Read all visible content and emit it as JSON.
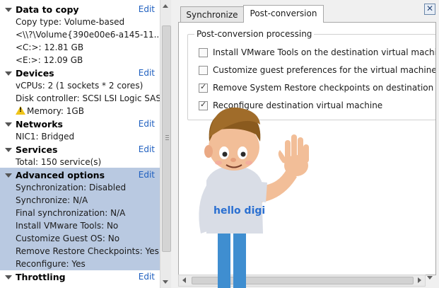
{
  "left_panel": {
    "sections": [
      {
        "title": "Data to copy",
        "edit": "Edit",
        "items": [
          "Copy type: Volume-based",
          "<\\\\?\\Volume{390e00e6-a145-11...",
          "<C:>: 12.81 GB",
          "<E:>: 12.09 GB"
        ]
      },
      {
        "title": "Devices",
        "edit": "Edit",
        "items": [
          "vCPUs: 2 (1 sockets * 2 cores)",
          "Disk controller: SCSI LSI Logic SAS",
          "Memory: 1GB"
        ]
      },
      {
        "title": "Networks",
        "edit": "Edit",
        "items": [
          "NIC1: Bridged"
        ]
      },
      {
        "title": "Services",
        "edit": "Edit",
        "items": [
          "Total: 150 service(s)"
        ]
      },
      {
        "title": "Advanced options",
        "edit": "Edit",
        "items": [
          "Synchronization: Disabled",
          "Synchronize: N/A",
          "Final synchronization: N/A",
          "Install VMware Tools: No",
          "Customize Guest OS: No",
          "Remove Restore Checkpoints: Yes",
          "Reconfigure: Yes"
        ]
      },
      {
        "title": "Throttling",
        "edit": "Edit",
        "items": []
      }
    ]
  },
  "tabs": [
    {
      "label": "Synchronize"
    },
    {
      "label": "Post-conversion"
    }
  ],
  "close_label": "✕",
  "post_conversion": {
    "group_title": "Post-conversion processing",
    "options": [
      {
        "label": "Install VMware Tools on the destination virtual machine",
        "checked": false
      },
      {
        "label": "Customize guest preferences for the virtual machine",
        "checked": false
      },
      {
        "label": "Remove System Restore checkpoints on destination",
        "checked": true
      },
      {
        "label": "Reconfigure destination virtual machine",
        "checked": true
      }
    ]
  },
  "mascot": {
    "shirt_text": "hello digi"
  },
  "colors": {
    "advanced_bg": "#b9c9e1",
    "edit_link": "#1f5fbf",
    "warning": "#f0c419"
  }
}
